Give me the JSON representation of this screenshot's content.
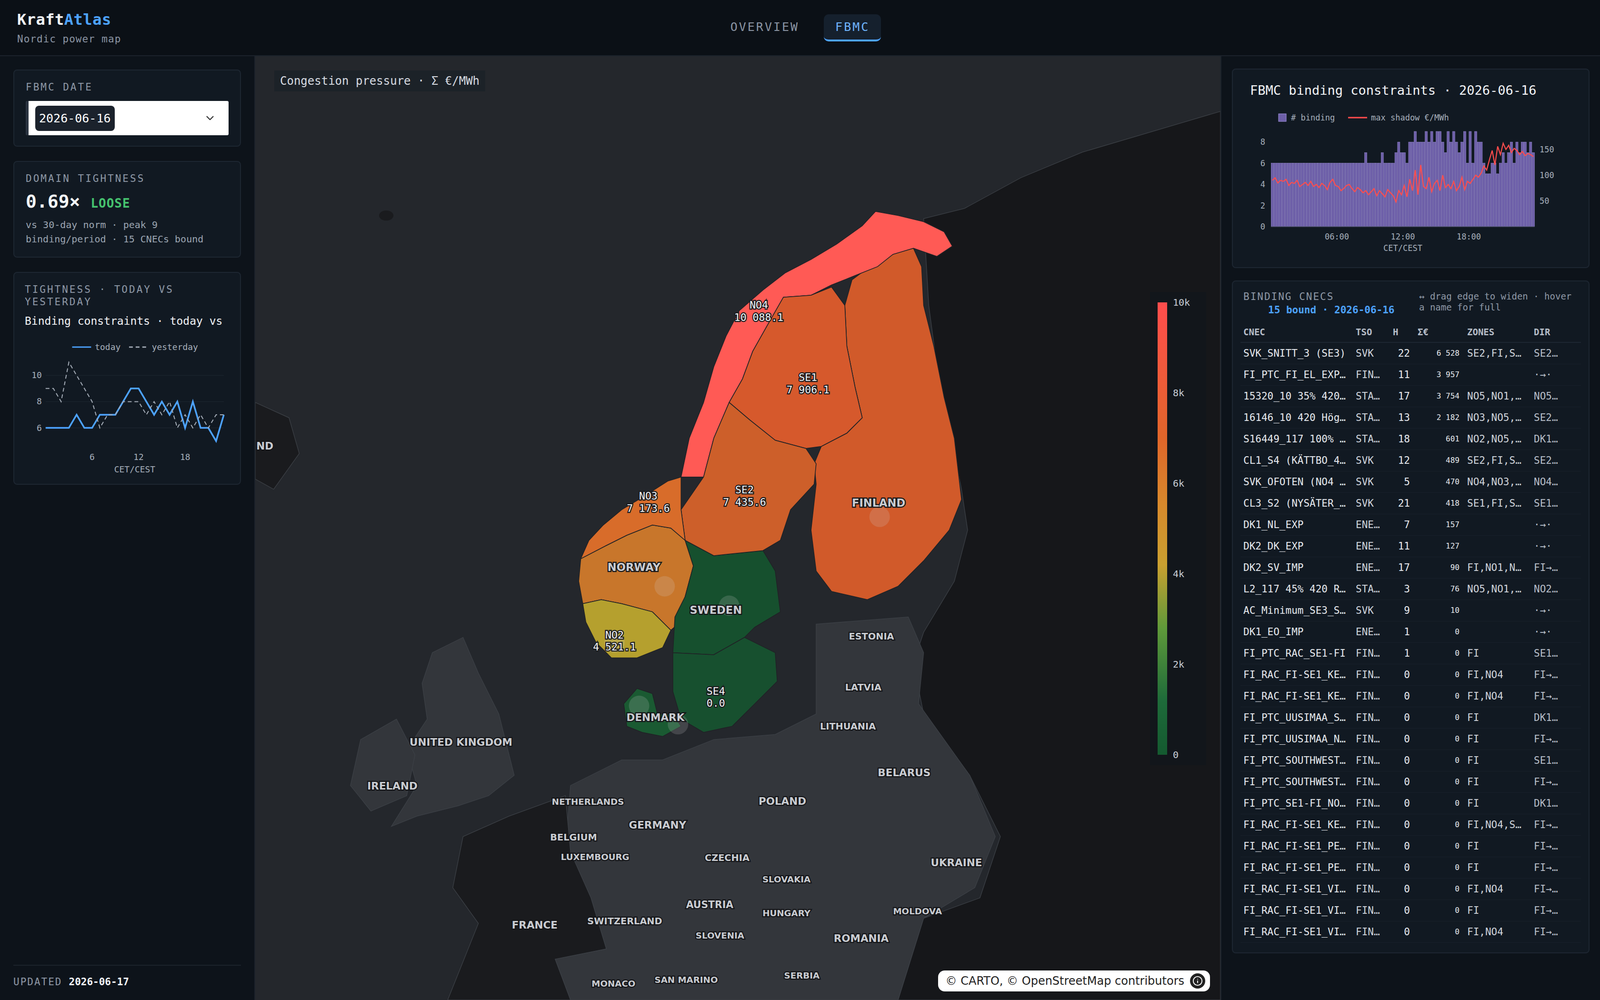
{
  "header": {
    "logo": {
      "primary": "Kraft",
      "accent": "Atlas"
    },
    "subtitle": "Nordic power map"
  },
  "tabs": [
    {
      "label": "OVERVIEW",
      "selected": false
    },
    {
      "label": "FBMC",
      "selected": true
    }
  ],
  "sidebar": {
    "date_card": {
      "label": "FBMC DATE",
      "value": "2026-06-16"
    },
    "tightness": {
      "label": "DOMAIN TIGHTNESS",
      "value": "0.69×",
      "badge": "LOOSE",
      "note": "vs 30-day norm · peak 9 binding/period · 15 CNECs bound"
    },
    "comparison": {
      "label": "TIGHTNESS · TODAY VS YESTERDAY",
      "title": "Binding constraints · today vs",
      "series": [
        {
          "name": "today",
          "dashed": false,
          "color": "#4da3ff",
          "values": [
            6,
            6,
            6,
            6,
            7,
            6,
            6,
            7,
            7,
            7,
            8,
            9,
            9,
            8,
            7,
            8,
            7,
            8,
            6,
            8,
            6,
            6,
            5,
            7
          ]
        },
        {
          "name": "yesterday",
          "dashed": true,
          "color": "#a3abb6",
          "values": [
            9,
            9,
            8,
            11,
            10,
            9,
            8,
            6,
            7,
            7,
            8,
            8,
            8,
            7,
            8,
            7,
            8,
            6,
            7,
            6,
            7,
            6,
            7,
            7
          ]
        }
      ],
      "y_ticks": [
        "6",
        "8",
        "10"
      ],
      "x_ticks": [
        "6",
        "12",
        "18"
      ],
      "x_label": "CET/CEST"
    },
    "updated": {
      "label": "UPDATED",
      "value": "2026-06-17"
    }
  },
  "map": {
    "title": "Congestion pressure · Σ €/MWh",
    "zones": [
      {
        "name": "NO4",
        "value": "10 088.1",
        "color": "#ff5a55"
      },
      {
        "name": "SE1",
        "value": "7 906.1",
        "color": "#d6592c"
      },
      {
        "name": "SE2",
        "value": "7 435.6",
        "color": "#cd5f2a"
      },
      {
        "name": "NO3",
        "value": "7 173.6",
        "color": "#d86c2a"
      },
      {
        "name": "NO2",
        "value": "4 521.1",
        "color": "#b5a02e"
      },
      {
        "name": "SE4",
        "value": "0.0",
        "color": "#17502f"
      }
    ],
    "areas": [
      {
        "color": "#c8762b"
      },
      {
        "color": "#d15a2a"
      },
      {
        "color": "#16502e"
      },
      {
        "color": "#1a5a32"
      }
    ],
    "labels": [
      "FINLAND",
      "NORWAY",
      "SWEDEN",
      "DENMARK",
      "ESTONIA",
      "LATVIA",
      "LITHUANIA",
      "UNITED KINGDOM",
      "IRELAND",
      "BELARUS",
      "POLAND",
      "NETHERLANDS",
      "GERMANY",
      "BELGIUM",
      "LUXEMBOURG",
      "CZECHIA",
      "UKRAINE",
      "SLOVAKIA",
      "AUSTRIA",
      "HUNGARY",
      "MOLDOVA",
      "FRANCE",
      "SWITZERLAND",
      "SLOVENIA",
      "ROMANIA",
      "MONACO",
      "SAN MARINO",
      "SERBIA",
      "ND"
    ],
    "legend": {
      "ticks": [
        "10k",
        "8k",
        "6k",
        "4k",
        "2k",
        "0"
      ]
    },
    "attribution": "© CARTO, © OpenStreetMap contributors"
  },
  "chart": {
    "title": "FBMC binding constraints · 2026-06-16",
    "legend": [
      "# binding",
      "max shadow €/MWh"
    ],
    "bars": [
      6,
      6,
      6,
      6,
      6,
      6,
      6,
      6,
      6,
      6,
      6,
      6,
      6,
      6,
      6,
      6,
      6,
      6,
      6,
      6,
      6,
      6,
      6,
      6,
      6,
      6,
      6,
      6,
      6,
      6,
      6,
      6,
      6,
      6,
      7,
      6,
      6,
      6,
      6,
      6,
      7,
      6,
      6,
      6,
      6,
      7,
      8,
      7,
      7,
      6,
      8,
      8,
      9,
      8,
      8,
      8,
      9,
      8,
      9,
      8,
      9,
      9,
      8,
      7,
      9,
      8,
      9,
      8,
      7,
      8,
      9,
      6,
      9,
      6,
      9,
      8,
      8,
      6,
      5,
      5,
      6,
      6,
      5,
      6,
      7,
      6,
      7,
      8,
      6,
      8,
      7,
      8,
      8,
      7,
      8,
      7
    ],
    "shadow": [
      90,
      95,
      85,
      90,
      88,
      92,
      80,
      86,
      84,
      90,
      78,
      82,
      86,
      80,
      88,
      78,
      82,
      76,
      84,
      80,
      72,
      86,
      92,
      80,
      78,
      70,
      74,
      80,
      82,
      74,
      68,
      76,
      72,
      66,
      70,
      62,
      68,
      74,
      60,
      70,
      64,
      58,
      72,
      66,
      60,
      48,
      70,
      62,
      80,
      58,
      92,
      70,
      110,
      62,
      120,
      78,
      74,
      96,
      68,
      84,
      90,
      70,
      100,
      76,
      82,
      74,
      88,
      70,
      78,
      96,
      72,
      88,
      84,
      92,
      100,
      96,
      104,
      118,
      110,
      130,
      148,
      120,
      156,
      140,
      162,
      150,
      158,
      144,
      152,
      148,
      140,
      146,
      138,
      142,
      140,
      136
    ],
    "left_ticks": [
      "0",
      "2",
      "4",
      "6",
      "8"
    ],
    "right_ticks": [
      "50",
      "100",
      "150"
    ],
    "x_ticks": [
      "06:00",
      "12:00",
      "18:00"
    ],
    "x_label": "CET/CEST"
  },
  "table": {
    "title": "BINDING CNECS",
    "subtitle": "15 bound · 2026-06-16",
    "hint": "↔ drag edge to widen · hover a name for full",
    "columns": [
      "CNEC",
      "TSO",
      "H",
      "Σ€",
      "ZONES",
      "DIR"
    ],
    "rows": [
      [
        "SVK_SNITT_3 (SE3)",
        "SVK",
        "22",
        "6 528",
        "SE2,FI,S…",
        "SE2…"
      ],
      [
        "FI_PTC_FI_EL_EXP…",
        "FIN…",
        "11",
        "3 957",
        "",
        "·→·"
      ],
      [
        "15320_10 35% 420…",
        "STA…",
        "17",
        "3 754",
        "NO5,NO1,…",
        "NO5…"
      ],
      [
        "16146_10 420 Hög…",
        "STA…",
        "13",
        "2 182",
        "NO3,NO5,…",
        "SE2…"
      ],
      [
        "S16449_117 100% …",
        "STA…",
        "18",
        "601",
        "NO2,NO5,…",
        "DK1…"
      ],
      [
        "CL1_S4 (KÄTTBO_4…",
        "SVK",
        "12",
        "489",
        "SE2,FI,S…",
        "SE2…"
      ],
      [
        "SVK_OFOTEN (NO4 …",
        "SVK",
        "5",
        "470",
        "NO4,NO3,…",
        "NO4…"
      ],
      [
        "CL3_S2 (NYSÄTER_…",
        "SVK",
        "21",
        "418",
        "SE1,FI,S…",
        "SE1…"
      ],
      [
        "DK1_NL_EXP",
        "ENE…",
        "7",
        "157",
        "",
        "·→·"
      ],
      [
        "DK2_DK_EXP",
        "ENE…",
        "11",
        "127",
        "",
        "·→·"
      ],
      [
        "DK2_SV_IMP",
        "ENE…",
        "17",
        "90",
        "FI,NO1,N…",
        "FI→…"
      ],
      [
        "L2_117 45% 420 R…",
        "STA…",
        "3",
        "76",
        "NO5,NO1,…",
        "NO2…"
      ],
      [
        "AC_Minimum_SE3_S…",
        "SVK",
        "9",
        "10",
        "",
        "·→·"
      ],
      [
        "DK1_EO_IMP",
        "ENE…",
        "1",
        "0",
        "",
        "·→·"
      ],
      [
        "FI_PTC_RAC_SE1-FI",
        "FIN…",
        "1",
        "0",
        "FI",
        "SE1…"
      ],
      [
        "FI_RAC_FI-SE1_KE…",
        "FIN…",
        "0",
        "0",
        "FI,NO4",
        "FI→…"
      ],
      [
        "FI_RAC_FI-SE1_KE…",
        "FIN…",
        "0",
        "0",
        "FI,NO4",
        "FI→…"
      ],
      [
        "FI_PTC_UUSIMAA_S…",
        "FIN…",
        "0",
        "0",
        "FI",
        "DK1…"
      ],
      [
        "FI_PTC_UUSIMAA_N…",
        "FIN…",
        "0",
        "0",
        "FI",
        "FI→…"
      ],
      [
        "FI_PTC_SOUTHWEST…",
        "FIN…",
        "0",
        "0",
        "FI",
        "SE1…"
      ],
      [
        "FI_PTC_SOUTHWEST…",
        "FIN…",
        "0",
        "0",
        "FI",
        "FI→…"
      ],
      [
        "FI_PTC_SE1-FI_NO…",
        "FIN…",
        "0",
        "0",
        "FI",
        "DK1…"
      ],
      [
        "FI_RAC_FI-SE1_KE…",
        "FIN…",
        "0",
        "0",
        "FI,NO4,S…",
        "FI→…"
      ],
      [
        "FI_RAC_FI-SE1_PE…",
        "FIN…",
        "0",
        "0",
        "FI",
        "FI→…"
      ],
      [
        "FI_RAC_FI-SE1_PE…",
        "FIN…",
        "0",
        "0",
        "FI",
        "FI→…"
      ],
      [
        "FI_RAC_FI-SE1_VI…",
        "FIN…",
        "0",
        "0",
        "FI,NO4",
        "FI→…"
      ],
      [
        "FI_RAC_FI-SE1_VI…",
        "FIN…",
        "0",
        "0",
        "FI",
        "FI→…"
      ],
      [
        "FI_RAC_FI-SE1_VI…",
        "FIN…",
        "0",
        "0",
        "FI,NO4",
        "FI→…"
      ]
    ]
  }
}
